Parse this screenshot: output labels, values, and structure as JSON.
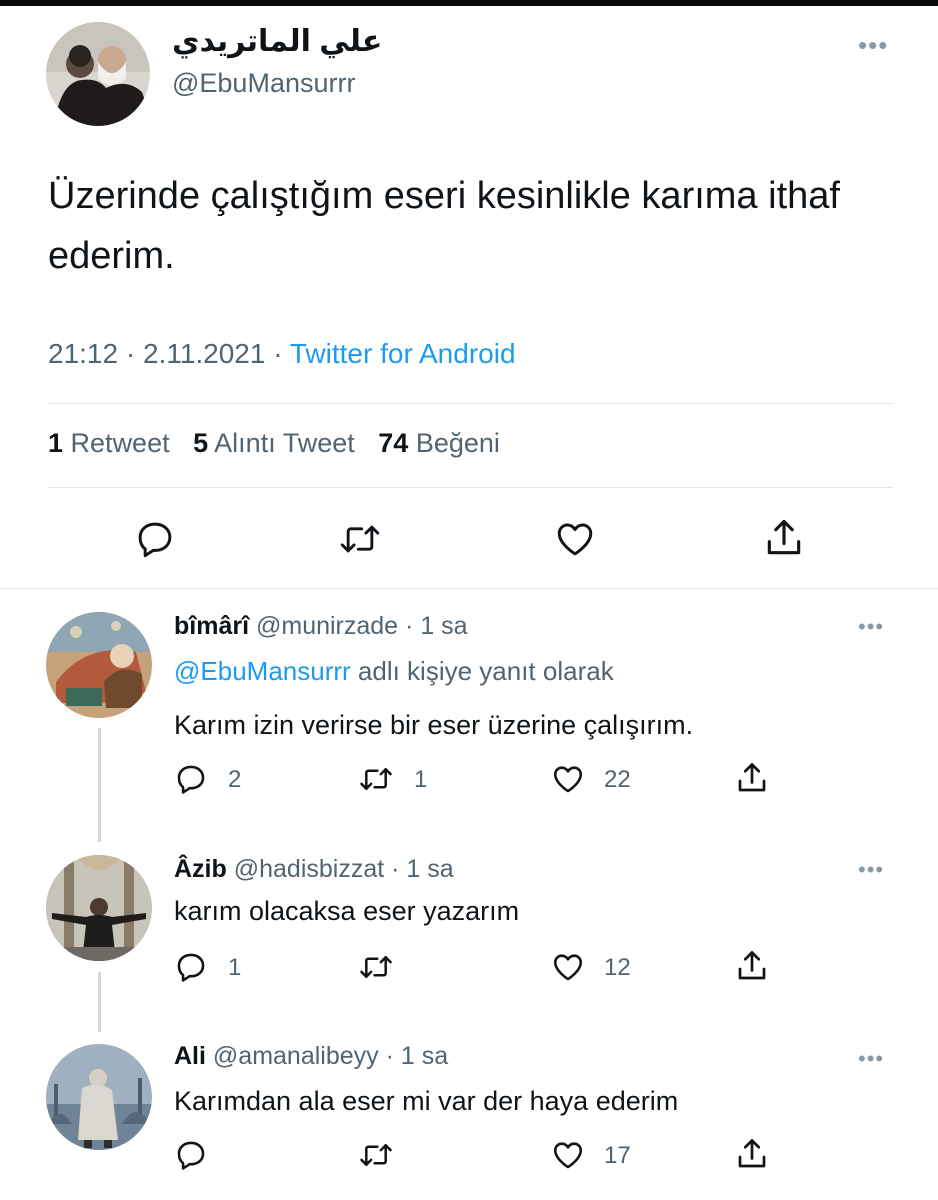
{
  "main_tweet": {
    "display_name": "علي الماتريدي",
    "handle": "@EbuMansurrr",
    "more_label": "•••",
    "text": "Üzerinde çalıştığım eseri kesinlikle karıma ithaf ederim.",
    "time": "21:12",
    "date": "2.11.2021",
    "separator": "·",
    "source": "Twitter for Android",
    "stats": {
      "retweets_count": "1",
      "retweets_label": "Retweet",
      "quotes_count": "5",
      "quotes_label": "Alıntı Tweet",
      "likes_count": "74",
      "likes_label": "Beğeni"
    }
  },
  "replies": [
    {
      "display_name": "bîmârî",
      "handle": "@munirzade",
      "time": "· 1 sa",
      "reply_mention": "@EbuMansurrr",
      "reply_suffix": "adlı kişiye yanıt olarak",
      "text": "Karım izin verirse bir eser üzerine çalışırım.",
      "replies": "2",
      "retweets": "1",
      "likes": "22"
    },
    {
      "display_name": "Âzib",
      "handle": "@hadisbizzat",
      "time": "· 1 sa",
      "text": "karım olacaksa eser yazarım",
      "replies": "1",
      "retweets": "",
      "likes": "12"
    },
    {
      "display_name": "Ali",
      "handle": "@amanalibeyy",
      "time": "· 1 sa",
      "text": "Karımdan ala eser mi var der haya ederim",
      "replies": "",
      "retweets": "",
      "likes": "17"
    }
  ],
  "colors": {
    "accent": "#1d9bf0",
    "secondary_text": "#536471",
    "primary_text": "#0f1419"
  },
  "icons": [
    "reply-icon",
    "retweet-icon",
    "like-icon",
    "share-icon",
    "more-icon"
  ]
}
